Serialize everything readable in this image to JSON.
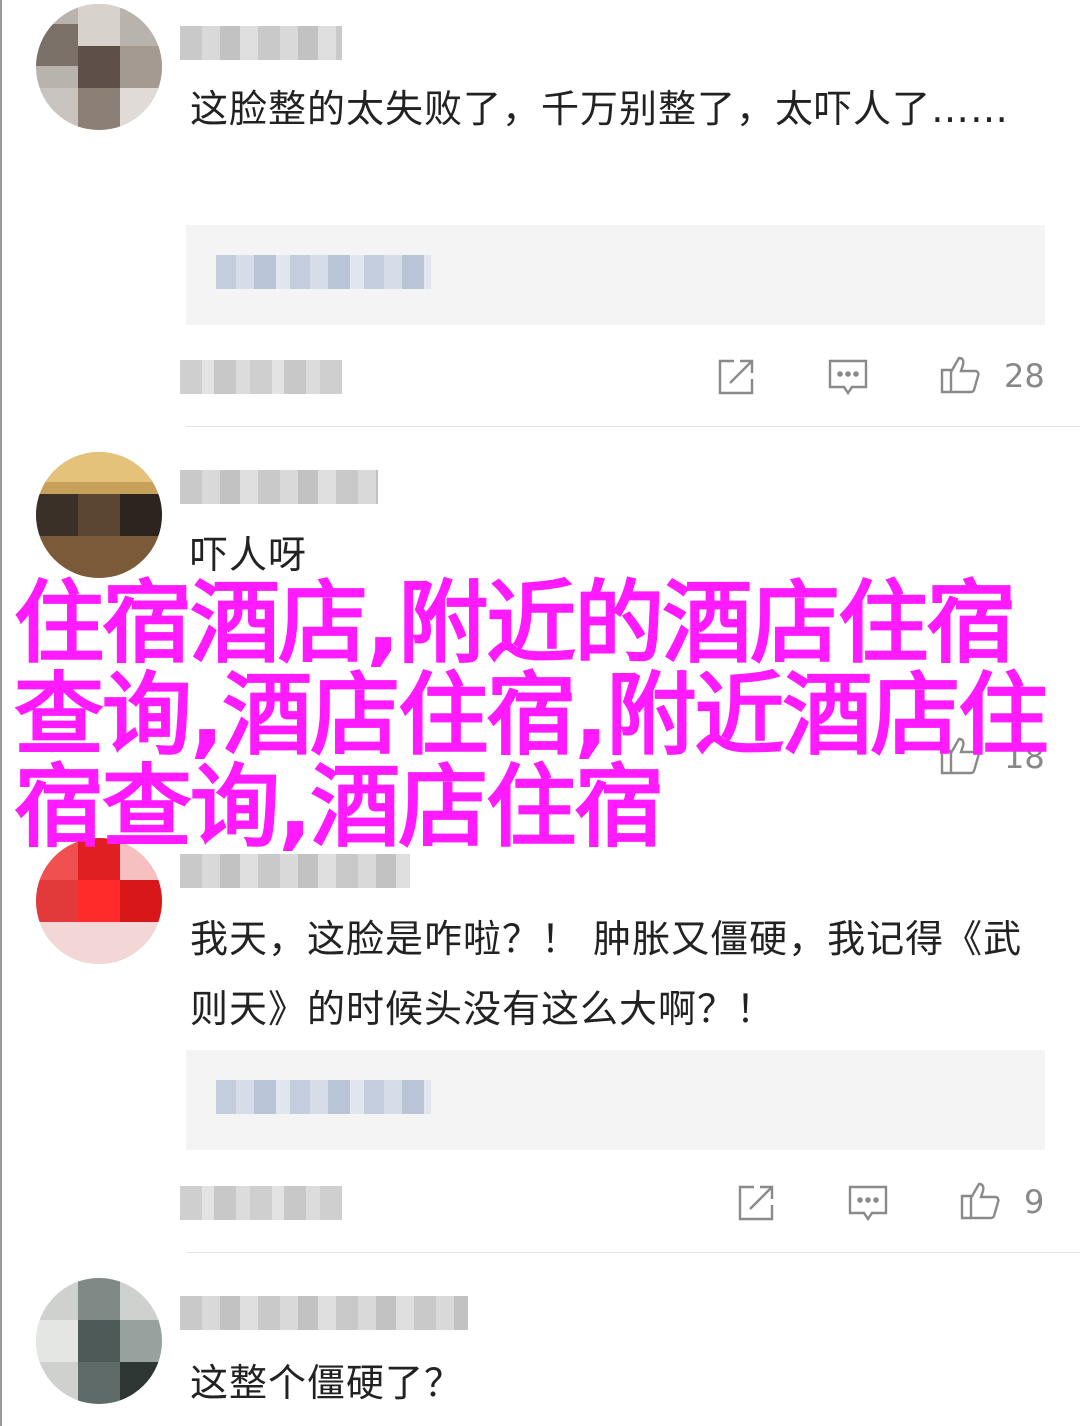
{
  "comments": [
    {
      "text": "这脸整的太失败了，千万别整了，太吓人了……",
      "likes": "28"
    },
    {
      "text": "吓人呀",
      "likes": "18"
    },
    {
      "text": "我天，这脸是咋啦？！ 肿胀又僵硬，我记得《武则天》的时候头没有这么大啊？！",
      "likes": "9"
    },
    {
      "text": "这整个僵硬了？",
      "likes": ""
    }
  ],
  "overlay": {
    "text": "住宿酒店,附近的酒店住宿查询,酒店住宿,附近酒店住宿查询,酒店住宿",
    "color": "#ff1aff"
  },
  "icons": {
    "share": "share-icon",
    "reply": "reply-icon",
    "like": "thumbs-up-icon"
  }
}
